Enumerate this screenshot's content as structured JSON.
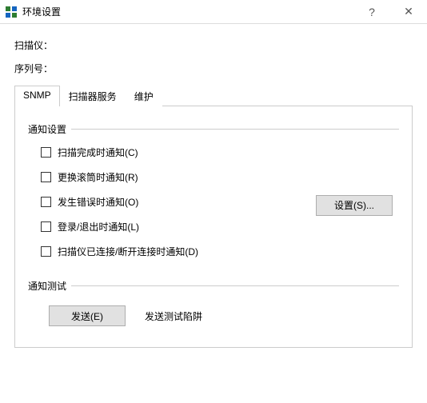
{
  "window": {
    "title": "环境设置",
    "help_glyph": "?",
    "close_glyph": "✕"
  },
  "info": {
    "scanner_label": "扫描仪：",
    "serial_label": "序列号："
  },
  "tabs": [
    {
      "label": "SNMP",
      "active": true
    },
    {
      "label": "扫描器服务",
      "active": false
    },
    {
      "label": "维护",
      "active": false
    }
  ],
  "notify_group": {
    "legend": "通知设置",
    "items": [
      "扫描完成时通知(C)",
      "更换滚筒时通知(R)",
      "发生错误时通知(O)",
      "登录/退出时通知(L)",
      "扫描仪已连接/断开连接时通知(D)"
    ],
    "settings_button": "设置(S)..."
  },
  "test_group": {
    "legend": "通知测试",
    "send_button": "发送(E)",
    "desc": "发送测试陷阱"
  }
}
